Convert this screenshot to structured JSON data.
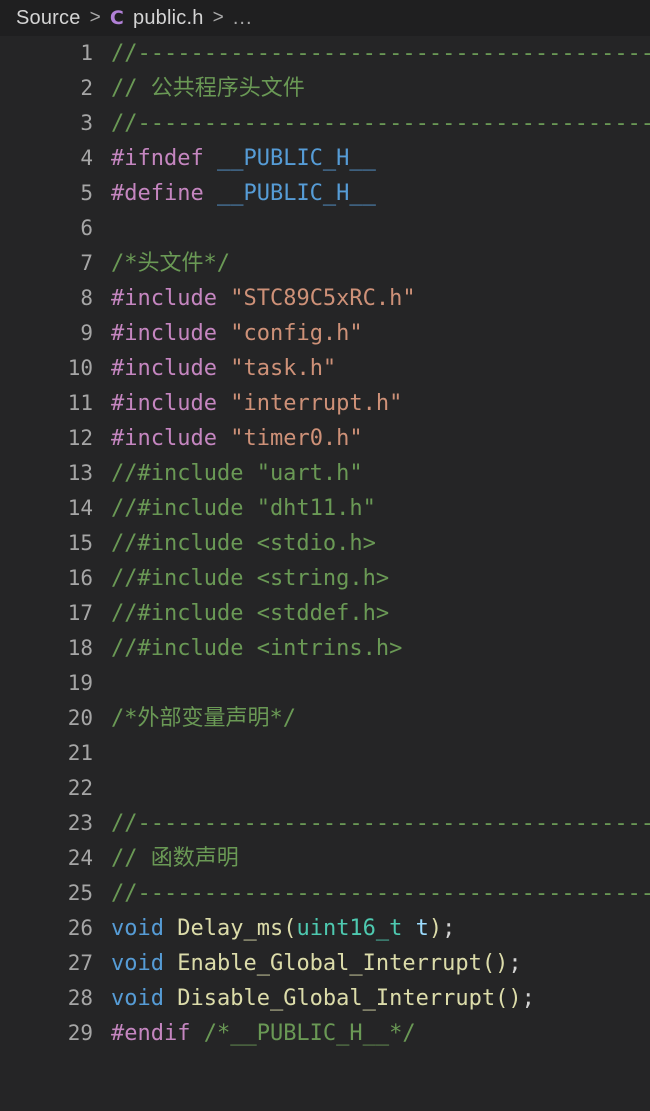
{
  "breadcrumb": {
    "root": "Source",
    "separator": ">",
    "file_icon": "C",
    "file": "public.h",
    "ellipsis": "..."
  },
  "editor": {
    "language": "c",
    "colors": {
      "background": "#252526",
      "breadcrumb_background": "#1f1f20",
      "line_number": "#a6a6a6",
      "comment": "#6a9955",
      "macro": "#c586c0",
      "define_name": "#569cd6",
      "string": "#ce9178",
      "keyword": "#569cd6",
      "function": "#dcdcaa",
      "type": "#4ec9b0",
      "variable": "#9cdcfe",
      "c_icon": "#b180d7"
    },
    "first_line": 1,
    "last_line": 29,
    "lines": [
      {
        "n": "1",
        "tokens": [
          {
            "c": "t-comment",
            "t": "//---------------------------------------------"
          }
        ]
      },
      {
        "n": "2",
        "tokens": [
          {
            "c": "t-comment",
            "t": "// "
          },
          {
            "c": "t-comment-zh",
            "t": "公共程序头文件"
          }
        ]
      },
      {
        "n": "3",
        "tokens": [
          {
            "c": "t-comment",
            "t": "//---------------------------------------------"
          }
        ]
      },
      {
        "n": "4",
        "tokens": [
          {
            "c": "t-macro",
            "t": "#ifndef "
          },
          {
            "c": "t-define",
            "t": "__PUBLIC_H__"
          }
        ]
      },
      {
        "n": "5",
        "tokens": [
          {
            "c": "t-macro",
            "t": "#define "
          },
          {
            "c": "t-define",
            "t": "__PUBLIC_H__"
          }
        ]
      },
      {
        "n": "6",
        "tokens": []
      },
      {
        "n": "7",
        "tokens": [
          {
            "c": "t-comment",
            "t": "/*"
          },
          {
            "c": "t-comment-zh",
            "t": "头文件"
          },
          {
            "c": "t-comment",
            "t": "*/"
          }
        ]
      },
      {
        "n": "8",
        "tokens": [
          {
            "c": "t-macro",
            "t": "#include "
          },
          {
            "c": "t-string",
            "t": "\"STC89C5xRC.h\""
          }
        ]
      },
      {
        "n": "9",
        "tokens": [
          {
            "c": "t-macro",
            "t": "#include "
          },
          {
            "c": "t-string",
            "t": "\"config.h\""
          }
        ]
      },
      {
        "n": "10",
        "tokens": [
          {
            "c": "t-macro",
            "t": "#include "
          },
          {
            "c": "t-string",
            "t": "\"task.h\""
          }
        ]
      },
      {
        "n": "11",
        "tokens": [
          {
            "c": "t-macro",
            "t": "#include "
          },
          {
            "c": "t-string",
            "t": "\"interrupt.h\""
          }
        ]
      },
      {
        "n": "12",
        "tokens": [
          {
            "c": "t-macro",
            "t": "#include "
          },
          {
            "c": "t-string",
            "t": "\"timer0.h\""
          }
        ]
      },
      {
        "n": "13",
        "tokens": [
          {
            "c": "t-comment",
            "t": "//#include \"uart.h\""
          }
        ]
      },
      {
        "n": "14",
        "tokens": [
          {
            "c": "t-comment",
            "t": "//#include \"dht11.h\""
          }
        ]
      },
      {
        "n": "15",
        "tokens": [
          {
            "c": "t-comment",
            "t": "//#include <stdio.h>"
          }
        ]
      },
      {
        "n": "16",
        "tokens": [
          {
            "c": "t-comment",
            "t": "//#include <string.h>"
          }
        ]
      },
      {
        "n": "17",
        "tokens": [
          {
            "c": "t-comment",
            "t": "//#include <stddef.h>"
          }
        ]
      },
      {
        "n": "18",
        "tokens": [
          {
            "c": "t-comment",
            "t": "//#include <intrins.h>"
          }
        ]
      },
      {
        "n": "19",
        "tokens": []
      },
      {
        "n": "20",
        "tokens": [
          {
            "c": "t-comment",
            "t": "/*"
          },
          {
            "c": "t-comment-zh",
            "t": "外部变量声明"
          },
          {
            "c": "t-comment",
            "t": "*/"
          }
        ]
      },
      {
        "n": "21",
        "tokens": []
      },
      {
        "n": "22",
        "tokens": []
      },
      {
        "n": "23",
        "tokens": [
          {
            "c": "t-comment",
            "t": "//---------------------------------------------"
          }
        ]
      },
      {
        "n": "24",
        "tokens": [
          {
            "c": "t-comment",
            "t": "// "
          },
          {
            "c": "t-comment-zh",
            "t": "函数声明"
          }
        ]
      },
      {
        "n": "25",
        "tokens": [
          {
            "c": "t-comment",
            "t": "//---------------------------------------------"
          }
        ]
      },
      {
        "n": "26",
        "tokens": [
          {
            "c": "t-keyword",
            "t": "void"
          },
          {
            "c": "t-punct",
            "t": " "
          },
          {
            "c": "t-func",
            "t": "Delay_ms"
          },
          {
            "c": "t-paren",
            "t": "("
          },
          {
            "c": "t-type",
            "t": "uint16_t"
          },
          {
            "c": "t-punct",
            "t": " "
          },
          {
            "c": "t-var",
            "t": "t"
          },
          {
            "c": "t-paren",
            "t": ")"
          },
          {
            "c": "t-punct",
            "t": ";"
          }
        ]
      },
      {
        "n": "27",
        "tokens": [
          {
            "c": "t-keyword",
            "t": "void"
          },
          {
            "c": "t-punct",
            "t": " "
          },
          {
            "c": "t-func",
            "t": "Enable_Global_Interrupt"
          },
          {
            "c": "t-paren",
            "t": "()"
          },
          {
            "c": "t-punct",
            "t": ";"
          }
        ]
      },
      {
        "n": "28",
        "tokens": [
          {
            "c": "t-keyword",
            "t": "void"
          },
          {
            "c": "t-punct",
            "t": " "
          },
          {
            "c": "t-func",
            "t": "Disable_Global_Interrupt"
          },
          {
            "c": "t-paren",
            "t": "()"
          },
          {
            "c": "t-punct",
            "t": ";"
          }
        ]
      },
      {
        "n": "29",
        "tokens": [
          {
            "c": "t-macro",
            "t": "#endif "
          },
          {
            "c": "t-comment",
            "t": "/*__PUBLIC_H__*/"
          }
        ]
      }
    ]
  }
}
